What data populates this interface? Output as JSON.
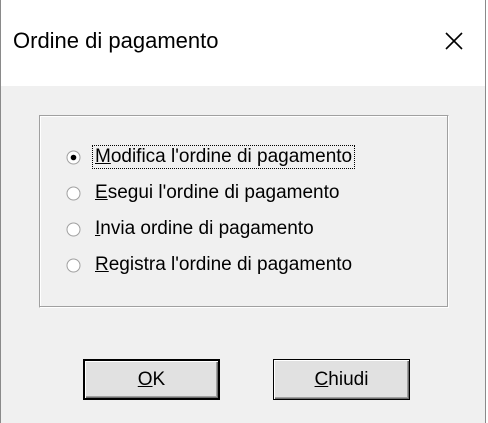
{
  "window": {
    "title": "Ordine di pagamento",
    "close_icon": "close-icon"
  },
  "options": {
    "selected_index": 0,
    "items": [
      {
        "mnemonic": "M",
        "rest": "odifica l'ordine di pagamento",
        "selected": true
      },
      {
        "mnemonic": "E",
        "rest": "segui l'ordine di pagamento",
        "selected": false
      },
      {
        "mnemonic": "I",
        "rest": "nvia ordine di pagamento",
        "selected": false
      },
      {
        "mnemonic": "R",
        "rest": "egistra l'ordine di pagamento",
        "selected": false
      }
    ]
  },
  "buttons": {
    "ok": {
      "mnemonic": "O",
      "rest": "K"
    },
    "close": {
      "mnemonic": "C",
      "rest": "hiudi"
    }
  },
  "colors": {
    "dialog_bg": "#f0f0f0",
    "titlebar_bg": "#ffffff",
    "button_bg": "#e1e1e1"
  }
}
